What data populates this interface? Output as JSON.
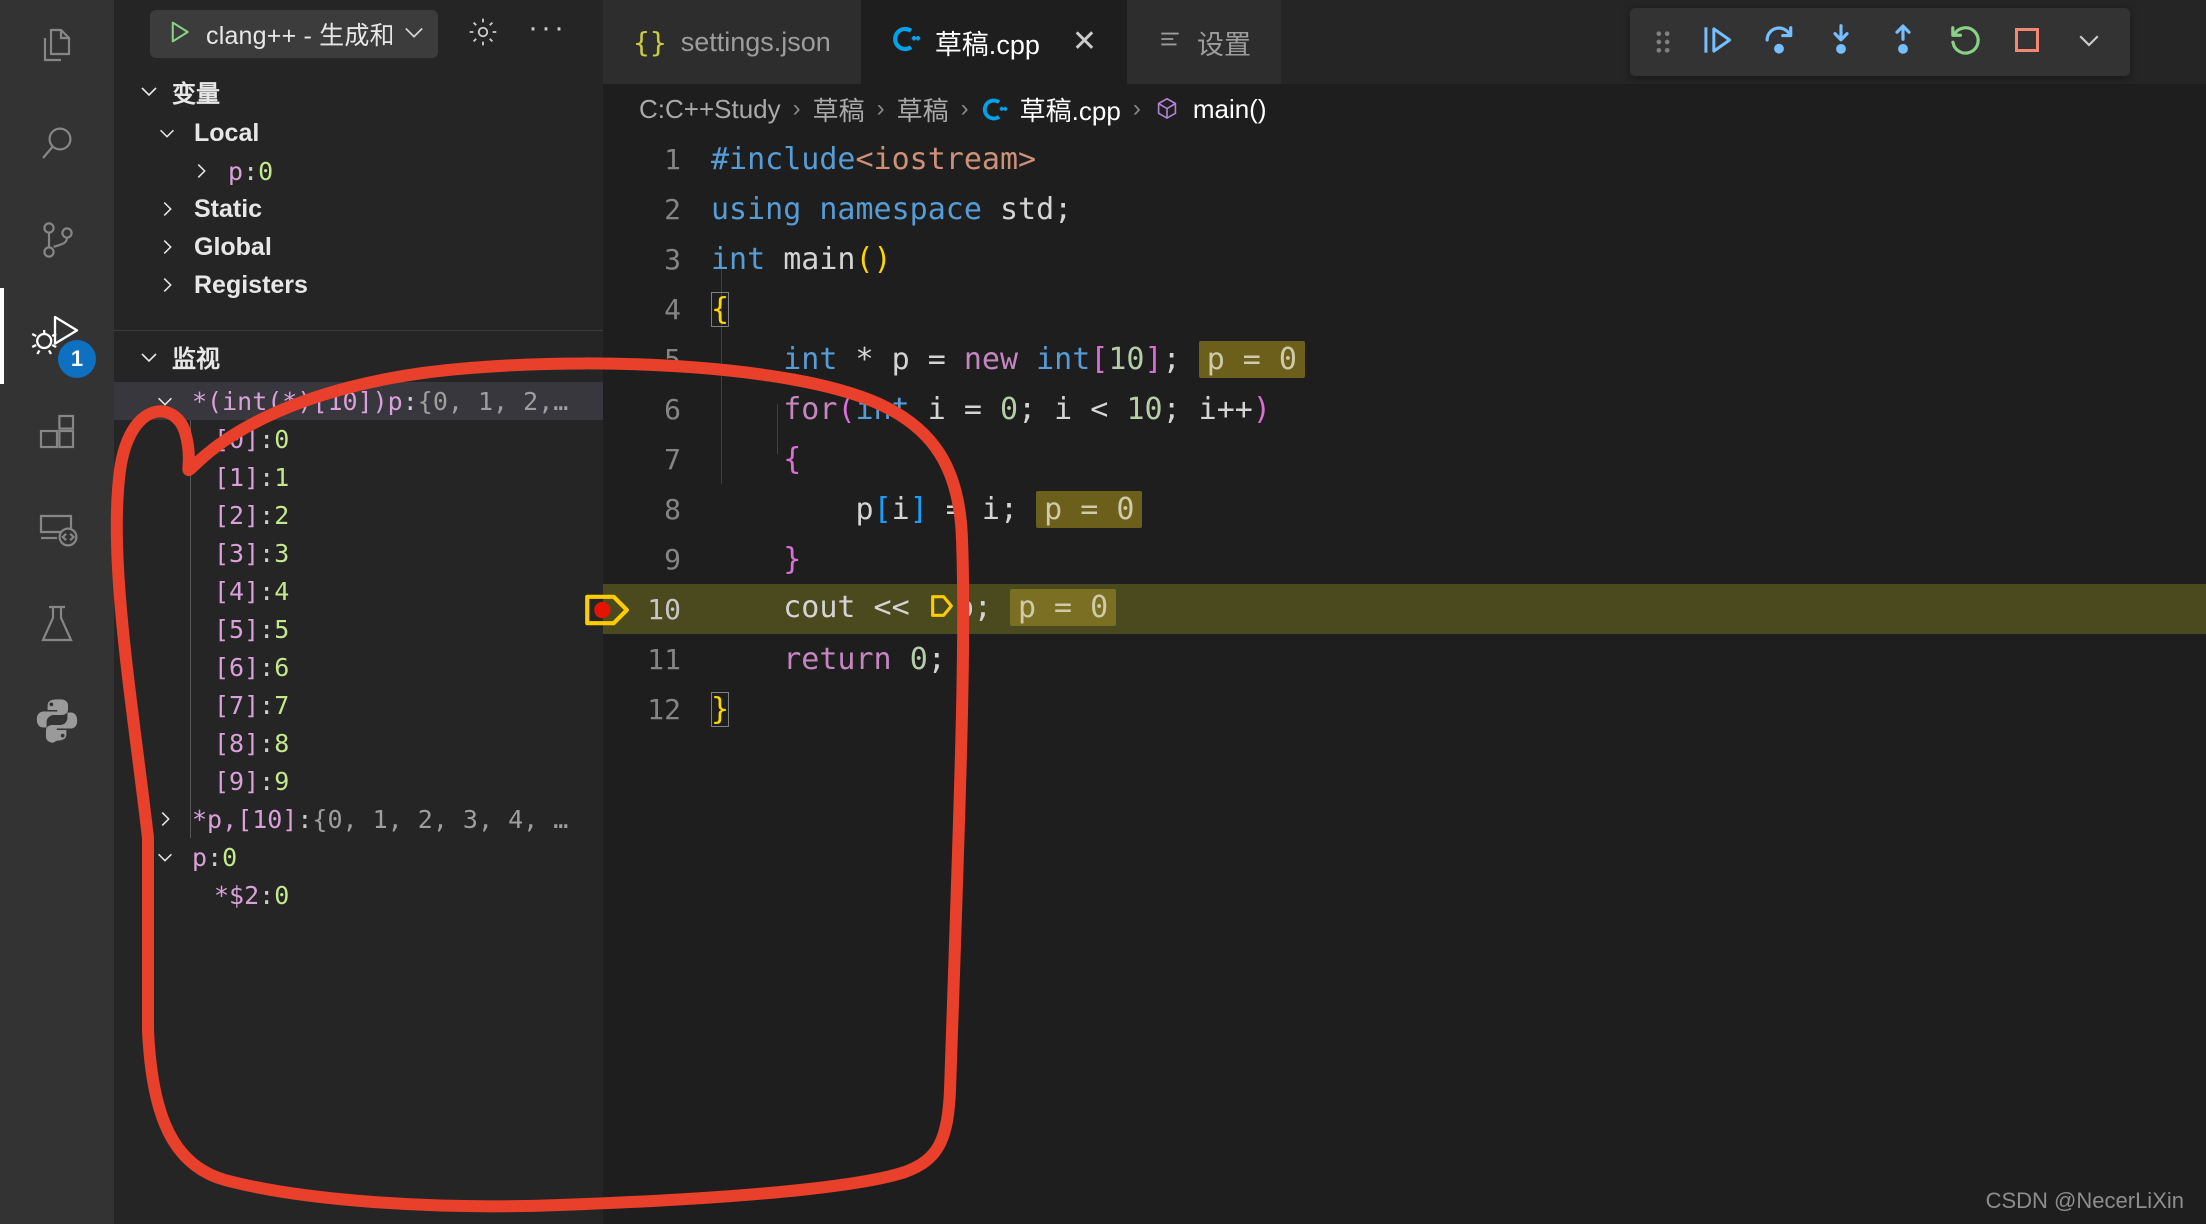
{
  "activity_bar": {
    "items": [
      {
        "name": "explorer",
        "icon": "files-icon",
        "active": false
      },
      {
        "name": "search",
        "icon": "search-icon",
        "active": false
      },
      {
        "name": "source-control",
        "icon": "source-control-icon",
        "active": false
      },
      {
        "name": "run-and-debug",
        "icon": "debug-icon",
        "active": true,
        "badge": "1"
      },
      {
        "name": "extensions",
        "icon": "extensions-icon",
        "active": false
      },
      {
        "name": "remote-explorer",
        "icon": "remote-explorer-icon",
        "active": false
      },
      {
        "name": "testing",
        "icon": "beaker-icon",
        "active": false
      },
      {
        "name": "python",
        "icon": "python-icon",
        "active": false
      }
    ]
  },
  "sidebar": {
    "launch_config": "clang++ - 生成和",
    "start_icon": "play-icon",
    "settings_icon": "gear-icon",
    "more_icon": "ellipsis-icon",
    "variables": {
      "title": "变量",
      "scopes": [
        {
          "label": "Local",
          "expanded": true,
          "children": [
            {
              "name": "p",
              "sep": ": ",
              "value": "0"
            }
          ]
        },
        {
          "label": "Static",
          "expanded": false,
          "children": []
        },
        {
          "label": "Global",
          "expanded": false,
          "children": []
        },
        {
          "label": "Registers",
          "expanded": false,
          "children": []
        }
      ]
    },
    "watch": {
      "title": "监视",
      "items": [
        {
          "name": "*(int(*)[10])p",
          "sep": ": ",
          "value": "{0, 1, 2,…",
          "expanded": true,
          "selected": true,
          "value_dim": true
        },
        {
          "name": "[0]",
          "sep": ": ",
          "value": "0",
          "child": true
        },
        {
          "name": "[1]",
          "sep": ": ",
          "value": "1",
          "child": true
        },
        {
          "name": "[2]",
          "sep": ": ",
          "value": "2",
          "child": true
        },
        {
          "name": "[3]",
          "sep": ": ",
          "value": "3",
          "child": true
        },
        {
          "name": "[4]",
          "sep": ": ",
          "value": "4",
          "child": true
        },
        {
          "name": "[5]",
          "sep": ": ",
          "value": "5",
          "child": true
        },
        {
          "name": "[6]",
          "sep": ": ",
          "value": "6",
          "child": true
        },
        {
          "name": "[7]",
          "sep": ": ",
          "value": "7",
          "child": true
        },
        {
          "name": "[8]",
          "sep": ": ",
          "value": "8",
          "child": true
        },
        {
          "name": "[9]",
          "sep": ": ",
          "value": "9",
          "child": true
        },
        {
          "name": "*p,[10]",
          "sep": ": ",
          "value": "{0, 1, 2, 3, 4, …",
          "expanded": false,
          "value_dim": true
        },
        {
          "name": "p",
          "sep": ": ",
          "value": "0",
          "expanded": true
        },
        {
          "name": "*$2",
          "sep": ": ",
          "value": "0",
          "child": true
        }
      ]
    }
  },
  "editor": {
    "tabs": [
      {
        "label": "settings.json",
        "icon": "json-icon",
        "active": false,
        "closable": false
      },
      {
        "label": "草稿.cpp",
        "icon": "cpp-icon",
        "active": true,
        "closable": true,
        "close_label": "✕"
      },
      {
        "label": "设置",
        "icon": "settings-tab-icon",
        "active": false,
        "closable": false
      }
    ],
    "breadcrumb": {
      "separator": "›",
      "parts": [
        "C:C++Study",
        "草稿",
        "草稿",
        "草稿.cpp",
        "main()"
      ],
      "file_icon": "cpp-icon",
      "symbol_icon": "method-icon"
    },
    "debug_toolbar": {
      "buttons": [
        {
          "name": "drag-handle",
          "icon": "grip-icon"
        },
        {
          "name": "continue",
          "icon": "continue-icon",
          "color": "#75beff"
        },
        {
          "name": "step-over",
          "icon": "step-over-icon",
          "color": "#75beff"
        },
        {
          "name": "step-into",
          "icon": "step-into-icon",
          "color": "#75beff"
        },
        {
          "name": "step-out",
          "icon": "step-out-icon",
          "color": "#75beff"
        },
        {
          "name": "restart",
          "icon": "restart-icon",
          "color": "#89d185"
        },
        {
          "name": "stop",
          "icon": "stop-icon",
          "color": "#f48771"
        },
        {
          "name": "more-actions",
          "icon": "chevron-down-icon",
          "color": "#cccccc"
        }
      ]
    },
    "current_line": 10,
    "lines": [
      {
        "n": "1",
        "tokens": [
          {
            "t": "#include",
            "c": "pp"
          },
          {
            "t": "<iostream>",
            "c": "str"
          }
        ]
      },
      {
        "n": "2",
        "tokens": [
          {
            "t": "using",
            "c": "kw"
          },
          {
            "t": " ",
            "c": "ident"
          },
          {
            "t": "namespace",
            "c": "kw"
          },
          {
            "t": " std;",
            "c": "ident"
          }
        ]
      },
      {
        "n": "3",
        "tokens": [
          {
            "t": "int",
            "c": "kw"
          },
          {
            "t": " main",
            "c": "ident"
          },
          {
            "t": "()",
            "c": "br-y"
          }
        ]
      },
      {
        "n": "4",
        "tokens": [
          {
            "t": "{",
            "c": "br-y box"
          }
        ]
      },
      {
        "n": "5",
        "tokens": [
          {
            "t": "    ",
            "c": "ident"
          },
          {
            "t": "int",
            "c": "kw"
          },
          {
            "t": " * p = ",
            "c": "ident"
          },
          {
            "t": "new",
            "c": "kw2"
          },
          {
            "t": " ",
            "c": "ident"
          },
          {
            "t": "int",
            "c": "kw"
          },
          {
            "t": "[",
            "c": "br-p"
          },
          {
            "t": "10",
            "c": "num"
          },
          {
            "t": "]",
            "c": "br-p"
          },
          {
            "t": ";",
            "c": "ident"
          }
        ],
        "inline": "p = 0"
      },
      {
        "n": "6",
        "tokens": [
          {
            "t": "    ",
            "c": "ident"
          },
          {
            "t": "for",
            "c": "kw2"
          },
          {
            "t": "(",
            "c": "br-p"
          },
          {
            "t": "int",
            "c": "kw"
          },
          {
            "t": " i = ",
            "c": "ident"
          },
          {
            "t": "0",
            "c": "num"
          },
          {
            "t": "; i < ",
            "c": "ident"
          },
          {
            "t": "10",
            "c": "num"
          },
          {
            "t": "; i++",
            "c": "ident"
          },
          {
            "t": ")",
            "c": "br-p"
          }
        ]
      },
      {
        "n": "7",
        "tokens": [
          {
            "t": "    ",
            "c": "ident"
          },
          {
            "t": "{",
            "c": "br-p"
          }
        ]
      },
      {
        "n": "8",
        "tokens": [
          {
            "t": "        p",
            "c": "ident"
          },
          {
            "t": "[",
            "c": "br-b"
          },
          {
            "t": "i",
            "c": "ident"
          },
          {
            "t": "]",
            "c": "br-b"
          },
          {
            "t": " = i;",
            "c": "ident"
          }
        ],
        "inline": "p = 0"
      },
      {
        "n": "9",
        "tokens": [
          {
            "t": "    ",
            "c": "ident"
          },
          {
            "t": "}",
            "c": "br-p"
          }
        ]
      },
      {
        "n": "10",
        "tokens": [
          {
            "t": "    cout << ",
            "c": "ident"
          },
          {
            "t": "⬠",
            "c": "bp-inline"
          },
          {
            "t": "p;",
            "c": "ident"
          }
        ],
        "inline": "p = 0",
        "highlight": true,
        "breakpoint": true
      },
      {
        "n": "11",
        "tokens": [
          {
            "t": "    ",
            "c": "ident"
          },
          {
            "t": "return",
            "c": "kw2"
          },
          {
            "t": " ",
            "c": "ident"
          },
          {
            "t": "0",
            "c": "num"
          },
          {
            "t": ";",
            "c": "ident"
          }
        ]
      },
      {
        "n": "12",
        "tokens": [
          {
            "t": "}",
            "c": "br-y box"
          }
        ]
      }
    ]
  },
  "watermark": "CSDN @NecerLiXin",
  "colors": {
    "accent": "#0e70c0",
    "annotation": "#e8402a",
    "highlight_line": "#4b4a1e",
    "breakpoint": "#e51400",
    "current_arrow": "#ffcc00"
  }
}
